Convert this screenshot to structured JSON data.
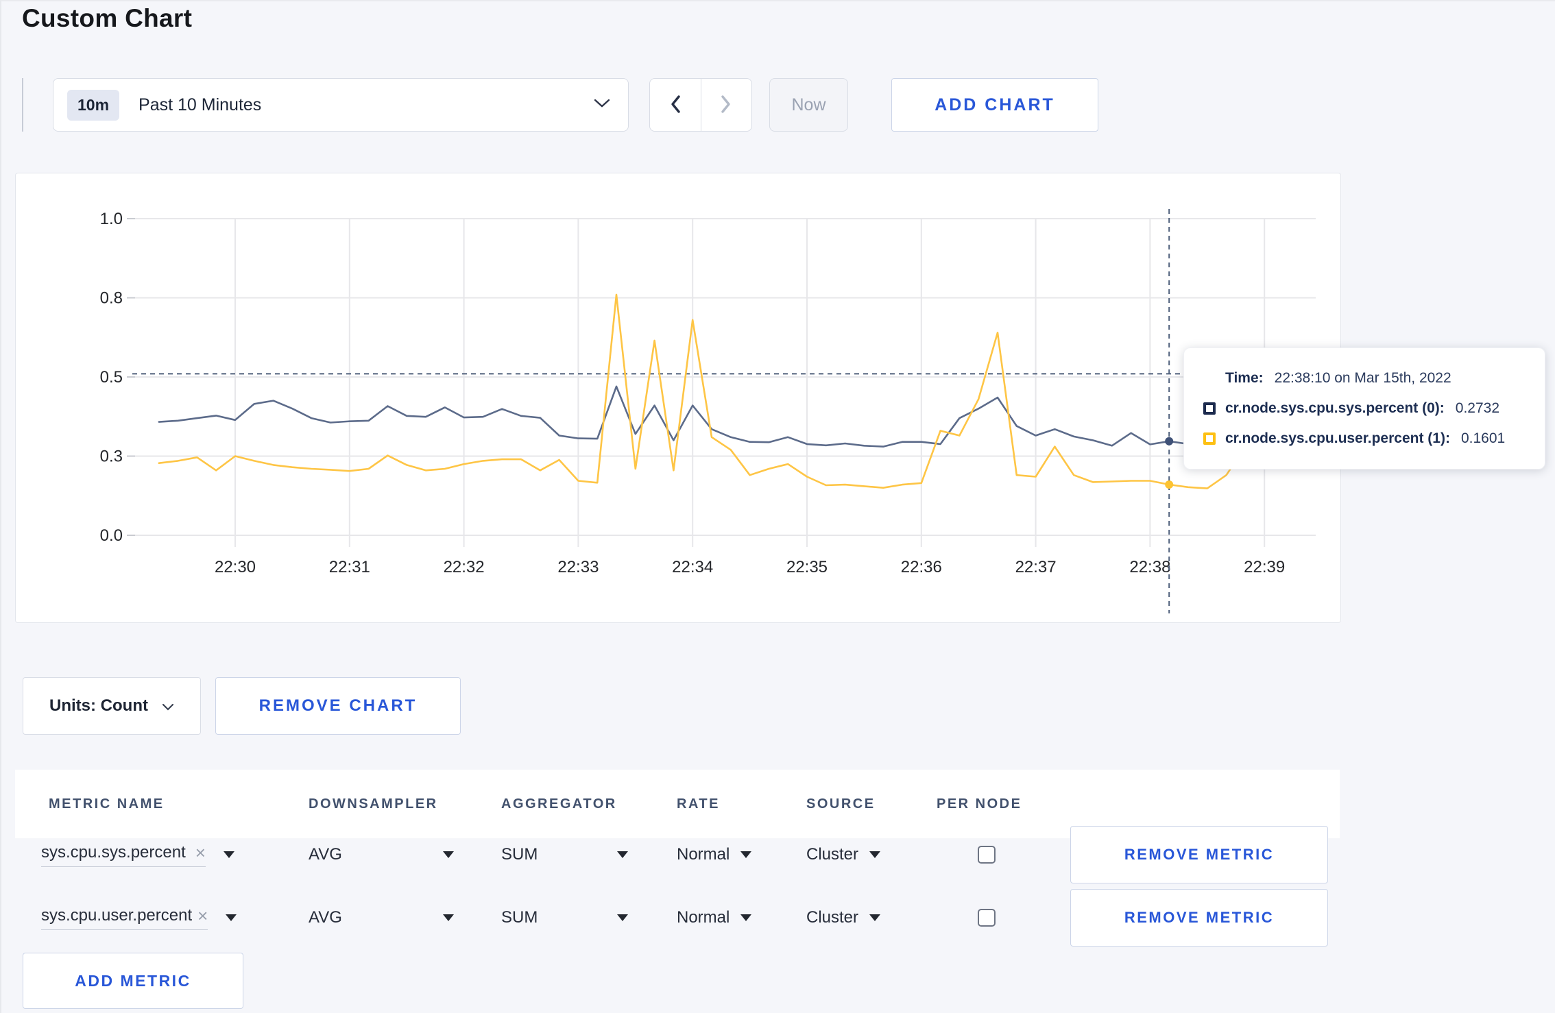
{
  "page": {
    "title": "Custom Chart"
  },
  "toolbar": {
    "time_range": {
      "badge": "10m",
      "label": "Past 10 Minutes"
    },
    "now_label": "Now",
    "add_chart_label": "ADD CHART"
  },
  "colors": {
    "accent_blue": "#2957d8",
    "grid": "#e7e7ea",
    "axis_text": "#25272b",
    "crosshair": "#50607c",
    "series_sys": "#5c6b8a",
    "series_user": "#fec545"
  },
  "chart_data": {
    "type": "line",
    "title": "",
    "xlabel": "",
    "ylabel": "",
    "ylim": [
      0,
      1
    ],
    "grid": true,
    "x_ticks": [
      "22:30",
      "22:31",
      "22:32",
      "22:33",
      "22:34",
      "22:35",
      "22:36",
      "22:37",
      "22:38",
      "22:39"
    ],
    "y_ticks": [
      {
        "label": "0.0",
        "value": 0.0
      },
      {
        "label": "0.3",
        "value": 0.25
      },
      {
        "label": "0.5",
        "value": 0.5
      },
      {
        "label": "0.8",
        "value": 0.75
      },
      {
        "label": "1.0",
        "value": 1.0
      }
    ],
    "start_time": "22:29:20",
    "interval_seconds": 10,
    "series": [
      {
        "name": "cr.node.sys.cpu.sys.percent",
        "color": "#5c6b8a",
        "dot_color": "#3f5177",
        "values": [
          0.358,
          0.362,
          0.37,
          0.378,
          0.364,
          0.415,
          0.425,
          0.4,
          0.37,
          0.356,
          0.36,
          0.362,
          0.408,
          0.377,
          0.374,
          0.404,
          0.372,
          0.374,
          0.399,
          0.377,
          0.371,
          0.315,
          0.306,
          0.305,
          0.47,
          0.32,
          0.41,
          0.3,
          0.41,
          0.335,
          0.31,
          0.295,
          0.294,
          0.31,
          0.288,
          0.284,
          0.29,
          0.283,
          0.28,
          0.295,
          0.295,
          0.288,
          0.37,
          0.4,
          0.435,
          0.345,
          0.315,
          0.335,
          0.312,
          0.3,
          0.283,
          0.323,
          0.287,
          0.297,
          0.288,
          0.29,
          0.3,
          0.315,
          0.3,
          0.302,
          0.3
        ]
      },
      {
        "name": "cr.node.sys.cpu.user.percent",
        "color": "#fec545",
        "dot_color": "#fdc331",
        "values": [
          0.228,
          0.235,
          0.246,
          0.205,
          0.25,
          0.235,
          0.222,
          0.215,
          0.21,
          0.207,
          0.203,
          0.21,
          0.252,
          0.222,
          0.205,
          0.21,
          0.225,
          0.235,
          0.24,
          0.24,
          0.205,
          0.238,
          0.172,
          0.166,
          0.76,
          0.21,
          0.615,
          0.205,
          0.68,
          0.31,
          0.27,
          0.19,
          0.21,
          0.225,
          0.185,
          0.158,
          0.16,
          0.155,
          0.15,
          0.16,
          0.165,
          0.33,
          0.315,
          0.43,
          0.64,
          0.19,
          0.185,
          0.28,
          0.19,
          0.168,
          0.17,
          0.172,
          0.172,
          0.1601,
          0.152,
          0.148,
          0.19,
          0.28,
          0.27,
          0.22,
          0.28
        ]
      }
    ],
    "crosshair": {
      "time": "22:38:10",
      "y_value": 0.51
    },
    "legend_position": "tooltip"
  },
  "tooltip": {
    "time_label": "Time:",
    "time_value": "22:38:10 on Mar 15th, 2022",
    "rows": [
      {
        "label": "cr.node.sys.cpu.sys.percent (0):",
        "value": "0.2732",
        "swatch": "#1c2b4e"
      },
      {
        "label": "cr.node.sys.cpu.user.percent (1):",
        "value": "0.1601",
        "swatch": "#fdc013"
      }
    ]
  },
  "chart_controls": {
    "units_label": "Units: Count",
    "remove_chart_label": "REMOVE CHART"
  },
  "metrics_table": {
    "headers": [
      "METRIC NAME",
      "DOWNSAMPLER",
      "AGGREGATOR",
      "RATE",
      "SOURCE",
      "PER NODE"
    ],
    "rows": [
      {
        "metric": "sys.cpu.sys.percent",
        "clear": "×",
        "downsampler": "AVG",
        "aggregator": "SUM",
        "rate": "Normal",
        "source": "Cluster",
        "per_node_checked": false,
        "remove_label": "REMOVE METRIC"
      },
      {
        "metric": "sys.cpu.user.percent",
        "clear": "×",
        "downsampler": "AVG",
        "aggregator": "SUM",
        "rate": "Normal",
        "source": "Cluster",
        "per_node_checked": false,
        "remove_label": "REMOVE METRIC"
      }
    ],
    "add_metric_label": "ADD METRIC"
  }
}
